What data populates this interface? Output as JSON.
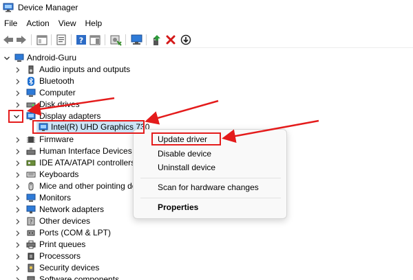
{
  "window": {
    "title": "Device Manager",
    "app_icon": "device-manager-icon"
  },
  "menu": [
    "File",
    "Action",
    "View",
    "Help"
  ],
  "toolbar": {
    "buttons": [
      "back-arrow-icon",
      "forward-arrow-icon",
      "show-hide-tree-icon",
      "properties-icon",
      "help-icon",
      "action-pane-icon",
      "scan-hardware-icon",
      "monitor-icon",
      "update-driver-icon",
      "uninstall-x-icon",
      "download-circle-icon"
    ]
  },
  "tree": {
    "root": "Android-Guru",
    "categories": [
      "Audio inputs and outputs",
      "Bluetooth",
      "Computer",
      "Disk drives",
      "Display adapters",
      "Firmware",
      "Human Interface Devices",
      "IDE ATA/ATAPI controllers",
      "Keyboards",
      "Mice and other pointing de",
      "Monitors",
      "Network adapters",
      "Other devices",
      "Ports (COM & LPT)",
      "Print queues",
      "Processors",
      "Security devices",
      "Software components"
    ],
    "display_child": "Intel(R) UHD Graphics 730"
  },
  "context_menu": {
    "update_driver": "Update driver",
    "disable_device": "Disable device",
    "uninstall_device": "Uninstall device",
    "scan_changes": "Scan for hardware changes",
    "properties": "Properties"
  },
  "colors": {
    "annotation_red": "#e41b1b",
    "selection_blue": "#cce4f7"
  }
}
